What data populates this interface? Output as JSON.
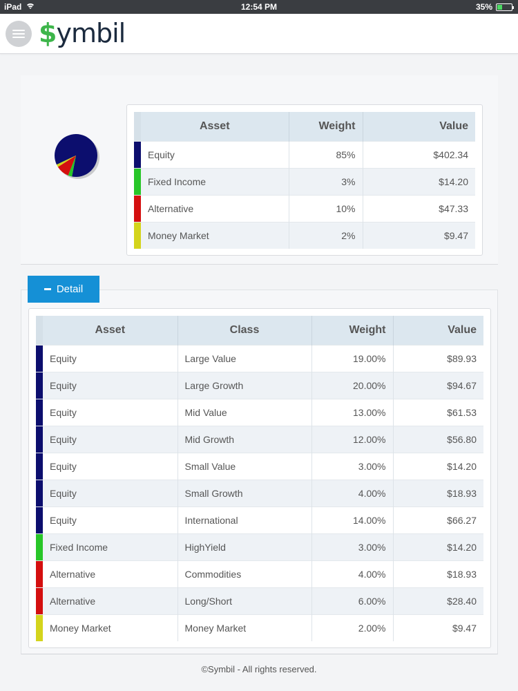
{
  "status_bar": {
    "device": "iPad",
    "time": "12:54 PM",
    "battery": "35%"
  },
  "app": {
    "logo_dollar": "$",
    "logo_text": "ymbil"
  },
  "colors": {
    "equity": "#0c0e6e",
    "fixed_income": "#28c628",
    "alternative": "#d40f0f",
    "money_market": "#d4d41c",
    "accent": "#1590d6"
  },
  "chart_data": {
    "type": "pie",
    "categories": [
      "Equity",
      "Fixed Income",
      "Alternative",
      "Money Market"
    ],
    "values": [
      85,
      3,
      10,
      2
    ]
  },
  "summary": {
    "headers": {
      "asset": "Asset",
      "weight": "Weight",
      "value": "Value"
    },
    "rows": [
      {
        "asset": "Equity",
        "weight": "85%",
        "value": "$402.34",
        "color": "#0c0e6e"
      },
      {
        "asset": "Fixed Income",
        "weight": "3%",
        "value": "$14.20",
        "color": "#28c628"
      },
      {
        "asset": "Alternative",
        "weight": "10%",
        "value": "$47.33",
        "color": "#d40f0f"
      },
      {
        "asset": "Money Market",
        "weight": "2%",
        "value": "$9.47",
        "color": "#d4d41c"
      }
    ]
  },
  "detail": {
    "button_label": "Detail",
    "headers": {
      "asset": "Asset",
      "class": "Class",
      "weight": "Weight",
      "value": "Value"
    },
    "rows": [
      {
        "asset": "Equity",
        "class": "Large Value",
        "weight": "19.00%",
        "value": "$89.93",
        "color": "#0c0e6e"
      },
      {
        "asset": "Equity",
        "class": "Large Growth",
        "weight": "20.00%",
        "value": "$94.67",
        "color": "#0c0e6e"
      },
      {
        "asset": "Equity",
        "class": "Mid Value",
        "weight": "13.00%",
        "value": "$61.53",
        "color": "#0c0e6e"
      },
      {
        "asset": "Equity",
        "class": "Mid Growth",
        "weight": "12.00%",
        "value": "$56.80",
        "color": "#0c0e6e"
      },
      {
        "asset": "Equity",
        "class": "Small Value",
        "weight": "3.00%",
        "value": "$14.20",
        "color": "#0c0e6e"
      },
      {
        "asset": "Equity",
        "class": "Small Growth",
        "weight": "4.00%",
        "value": "$18.93",
        "color": "#0c0e6e"
      },
      {
        "asset": "Equity",
        "class": "International",
        "weight": "14.00%",
        "value": "$66.27",
        "color": "#0c0e6e"
      },
      {
        "asset": "Fixed Income",
        "class": "HighYield",
        "weight": "3.00%",
        "value": "$14.20",
        "color": "#28c628"
      },
      {
        "asset": "Alternative",
        "class": "Commodities",
        "weight": "4.00%",
        "value": "$18.93",
        "color": "#d40f0f"
      },
      {
        "asset": "Alternative",
        "class": "Long/Short",
        "weight": "6.00%",
        "value": "$28.40",
        "color": "#d40f0f"
      },
      {
        "asset": "Money Market",
        "class": "Money Market",
        "weight": "2.00%",
        "value": "$9.47",
        "color": "#d4d41c"
      }
    ]
  },
  "footer": {
    "text": "©Symbil - All rights reserved."
  }
}
